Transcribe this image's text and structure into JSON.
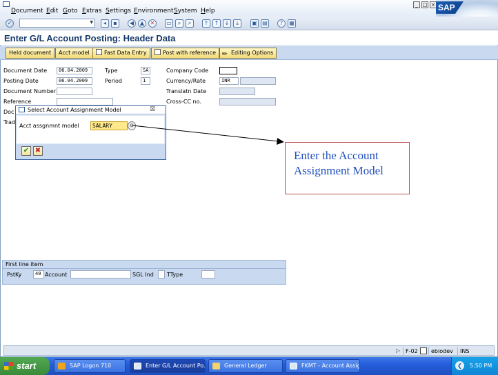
{
  "menu": [
    "Document",
    "Edit",
    "Goto",
    "Extras",
    "Settings",
    "Environment",
    "System",
    "Help"
  ],
  "logo": "SAP",
  "page_title": "Enter G/L Account Posting: Header Data",
  "app_toolbar": {
    "held_document": "Held document",
    "acct_model": "Acct model",
    "fast_data_entry": "Fast Data Entry",
    "post_with_reference": "Post with reference",
    "editing_options": "Editing Options"
  },
  "header": {
    "document_date_label": "Document Date",
    "document_date": "06.04.2009",
    "posting_date_label": "Posting Date",
    "posting_date": "06.04.2009",
    "document_number_label": "Document Number",
    "reference_label": "Reference",
    "doc_label_partial": "Doc",
    "trad_label_partial": "Trad",
    "type_label": "Type",
    "type_value": "SA",
    "period_label": "Period",
    "period_value": "1",
    "company_code_label": "Company Code",
    "currency_rate_label": "Currency/Rate",
    "currency_value": "INR",
    "translatn_date_label": "Translatn Date",
    "cross_cc_label": "Cross-CC no."
  },
  "dialog": {
    "title": "Select Account Assignment Model",
    "field_label": "Acct assgnmnt model",
    "field_value": "SALARY",
    "ok_symbol": "✔",
    "cancel_symbol": "✖",
    "close_symbol": "☒"
  },
  "callout": {
    "text": "Enter the Account Assignment Model"
  },
  "first_line_item": {
    "title": "First line item",
    "pstky_label": "PstKy",
    "pstky_value": "40",
    "account_label": "Account",
    "sgl_ind_label": "SGL Ind",
    "ttype_label": "TType"
  },
  "statusbar": {
    "transaction": "F-02",
    "server": "ebiodev",
    "mode": "INS"
  },
  "taskbar": {
    "start": "start",
    "tasks": [
      "SAP Logon 710",
      "Enter G/L Account Po...",
      "General Ledger",
      "FKMT - Account Assig..."
    ],
    "time": "5:50 PM"
  }
}
